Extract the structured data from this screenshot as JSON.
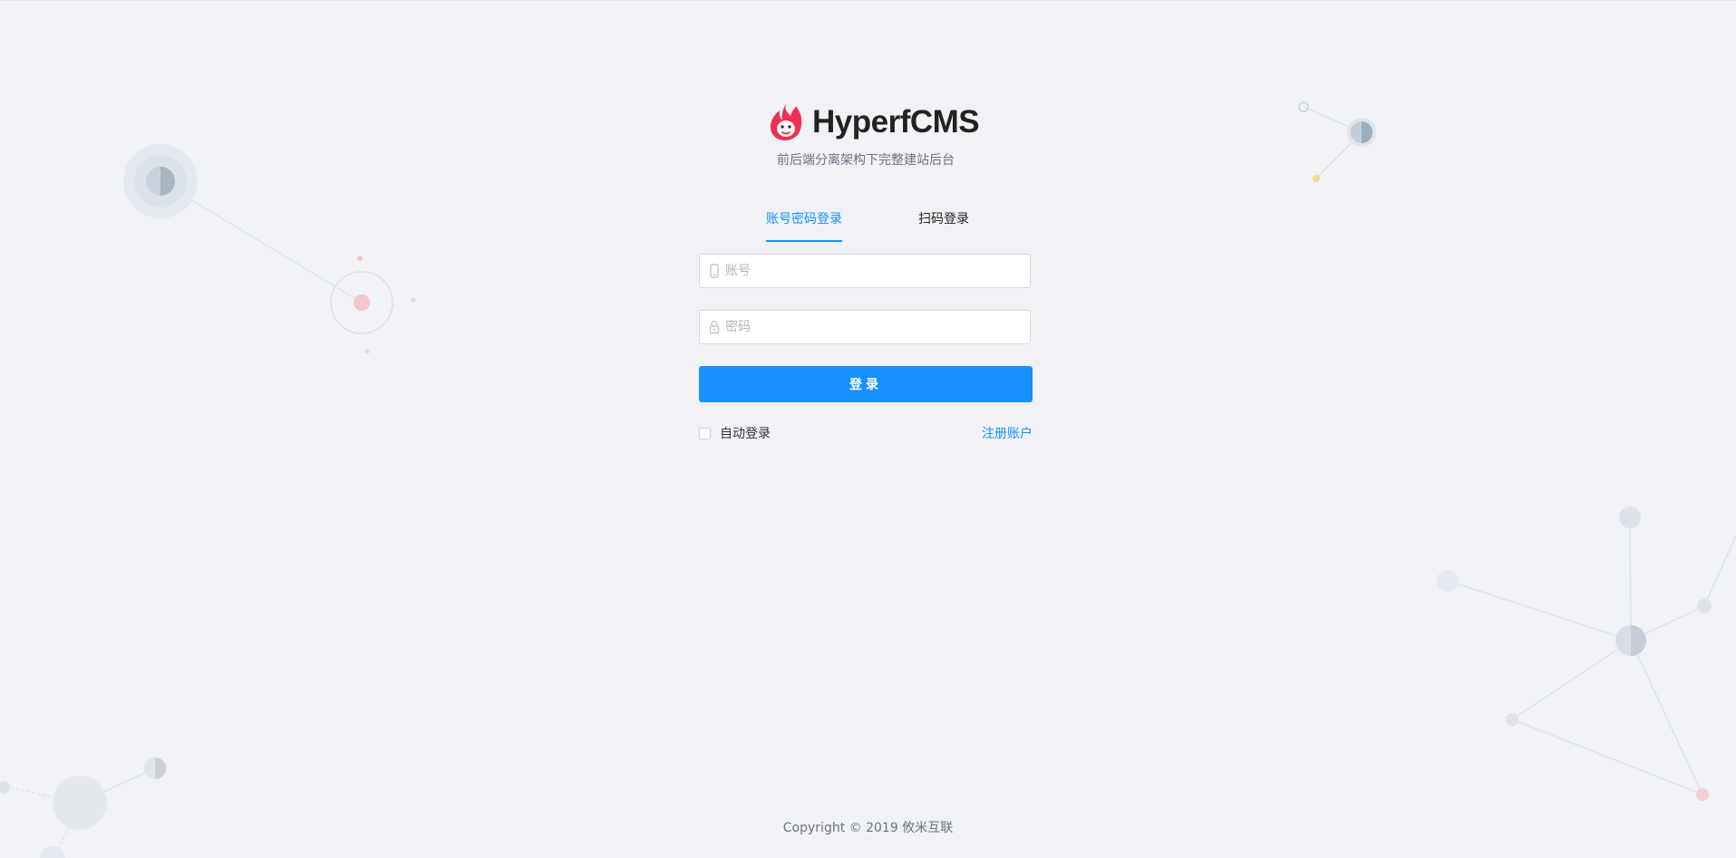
{
  "brand": {
    "name": "HyperfCMS",
    "logo_icon": "flame-monkey-logo"
  },
  "subtitle": "前后端分离架构下完整建站后台",
  "tabs": [
    {
      "label": "账号密码登录",
      "active": true
    },
    {
      "label": "扫码登录",
      "active": false
    }
  ],
  "form": {
    "account": {
      "placeholder": "账号",
      "value": "",
      "icon": "mobile-icon"
    },
    "password": {
      "placeholder": "密码",
      "value": "",
      "icon": "lock-icon"
    },
    "submit_label": "登录",
    "auto_login_label": "自动登录",
    "auto_login_checked": false,
    "register_label": "注册账户"
  },
  "footer": {
    "copyright_label": "Copyright",
    "copyright_symbol": "©",
    "year": "2019",
    "company": "攸米互联"
  },
  "colors": {
    "background": "#f0f2f5",
    "accent": "#1890ff",
    "brand_red": "#ef2f53",
    "text_primary": "#222222",
    "text_secondary": "#6b7280"
  }
}
